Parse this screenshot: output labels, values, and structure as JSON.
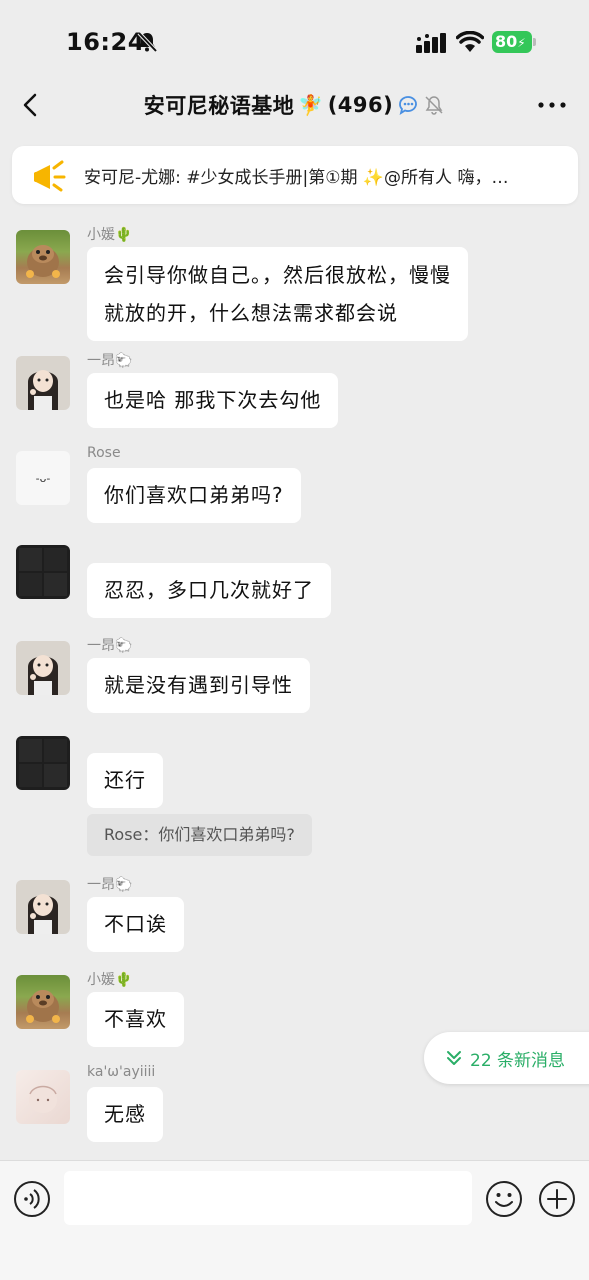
{
  "status_bar": {
    "time": "16:24",
    "battery": "80"
  },
  "nav": {
    "title": "安可尼秘语基地",
    "title_emoji": "🧚",
    "member_count": "(496)"
  },
  "announcement": {
    "text": "安可尼-尤娜: #少女成长手册|第①期 ✨@所有人  嗨，…"
  },
  "messages": [
    {
      "sender": "小媛🌵",
      "lines": [
        "会引导你做自己。，然后很放松，慢慢",
        "就放的开，什么想法需求都会说"
      ]
    },
    {
      "sender": "一昂🐑",
      "text": "也是哈 那我下次去勾他"
    },
    {
      "sender": "Rose",
      "text": "你们喜欢口弟弟吗?",
      "avatar_face": "-ᴗ-"
    },
    {
      "sender": "",
      "text": "忍忍，多口几次就好了"
    },
    {
      "sender": "一昂🐑",
      "text": "就是没有遇到引导性"
    },
    {
      "sender": "",
      "text": "还行"
    },
    {
      "sender": "一昂🐑",
      "text": "不口诶"
    },
    {
      "sender": "小媛🌵",
      "text": "不喜欢"
    },
    {
      "sender": "ka'ω'ayiiii",
      "text": "无感"
    }
  ],
  "quote": {
    "text": "Rose：你们喜欢口弟弟吗?"
  },
  "new_messages": {
    "label": "22 条新消息"
  },
  "input": {
    "value": "",
    "placeholder": ""
  },
  "colors": {
    "accent_green": "#2aae67",
    "battery_green": "#34c759",
    "background": "#ededed"
  }
}
